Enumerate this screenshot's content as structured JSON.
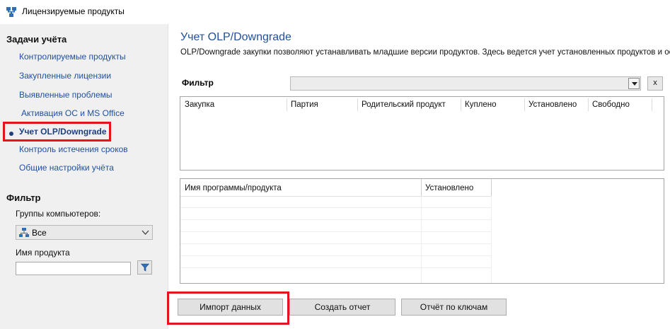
{
  "window": {
    "title": "Лицензируемые продукты",
    "icon": "network-app-icon"
  },
  "sidebar": {
    "tasks_title": "Задачи учёта",
    "items": [
      {
        "label": "Контролируемые продукты",
        "active": false
      },
      {
        "label": "Закупленные лицензии",
        "active": false
      },
      {
        "label": "Выявленные проблемы",
        "active": false
      },
      {
        "label": "Активация ОС и MS Office",
        "active": false
      },
      {
        "label": "Учет OLP/Downgrade",
        "active": true
      },
      {
        "label": "Контроль истечения сроков",
        "active": false
      },
      {
        "label": "Общие настройки учёта",
        "active": false
      }
    ],
    "filter_title": "Фильтр",
    "groups_label": "Группы компьютеров:",
    "groups_value": "Все",
    "product_label": "Имя продукта",
    "product_value": ""
  },
  "main": {
    "title": "Учет OLP/Downgrade",
    "description": "OLP/Downgrade закупки позволяют устанавливать младшие версии продуктов. Здесь ведется учет установленных продуктов и ос",
    "filter_label": "Фильтр",
    "filter_value": "",
    "clear_label": "x",
    "purchases_table": {
      "columns": [
        "Закупка",
        "Партия",
        "Родительский продукт",
        "Куплено",
        "Установлено",
        "Свободно"
      ],
      "rows": []
    },
    "programs_table": {
      "columns": [
        "Имя программы/продукта",
        "Установлено"
      ],
      "rows": []
    },
    "buttons": {
      "import": "Импорт данных",
      "report": "Создать отчет",
      "keys_report": "Отчёт по ключам"
    }
  },
  "colors": {
    "link": "#1f4f9f",
    "highlight": "#e3141e",
    "sidebar_bg": "#f0f0f0"
  }
}
